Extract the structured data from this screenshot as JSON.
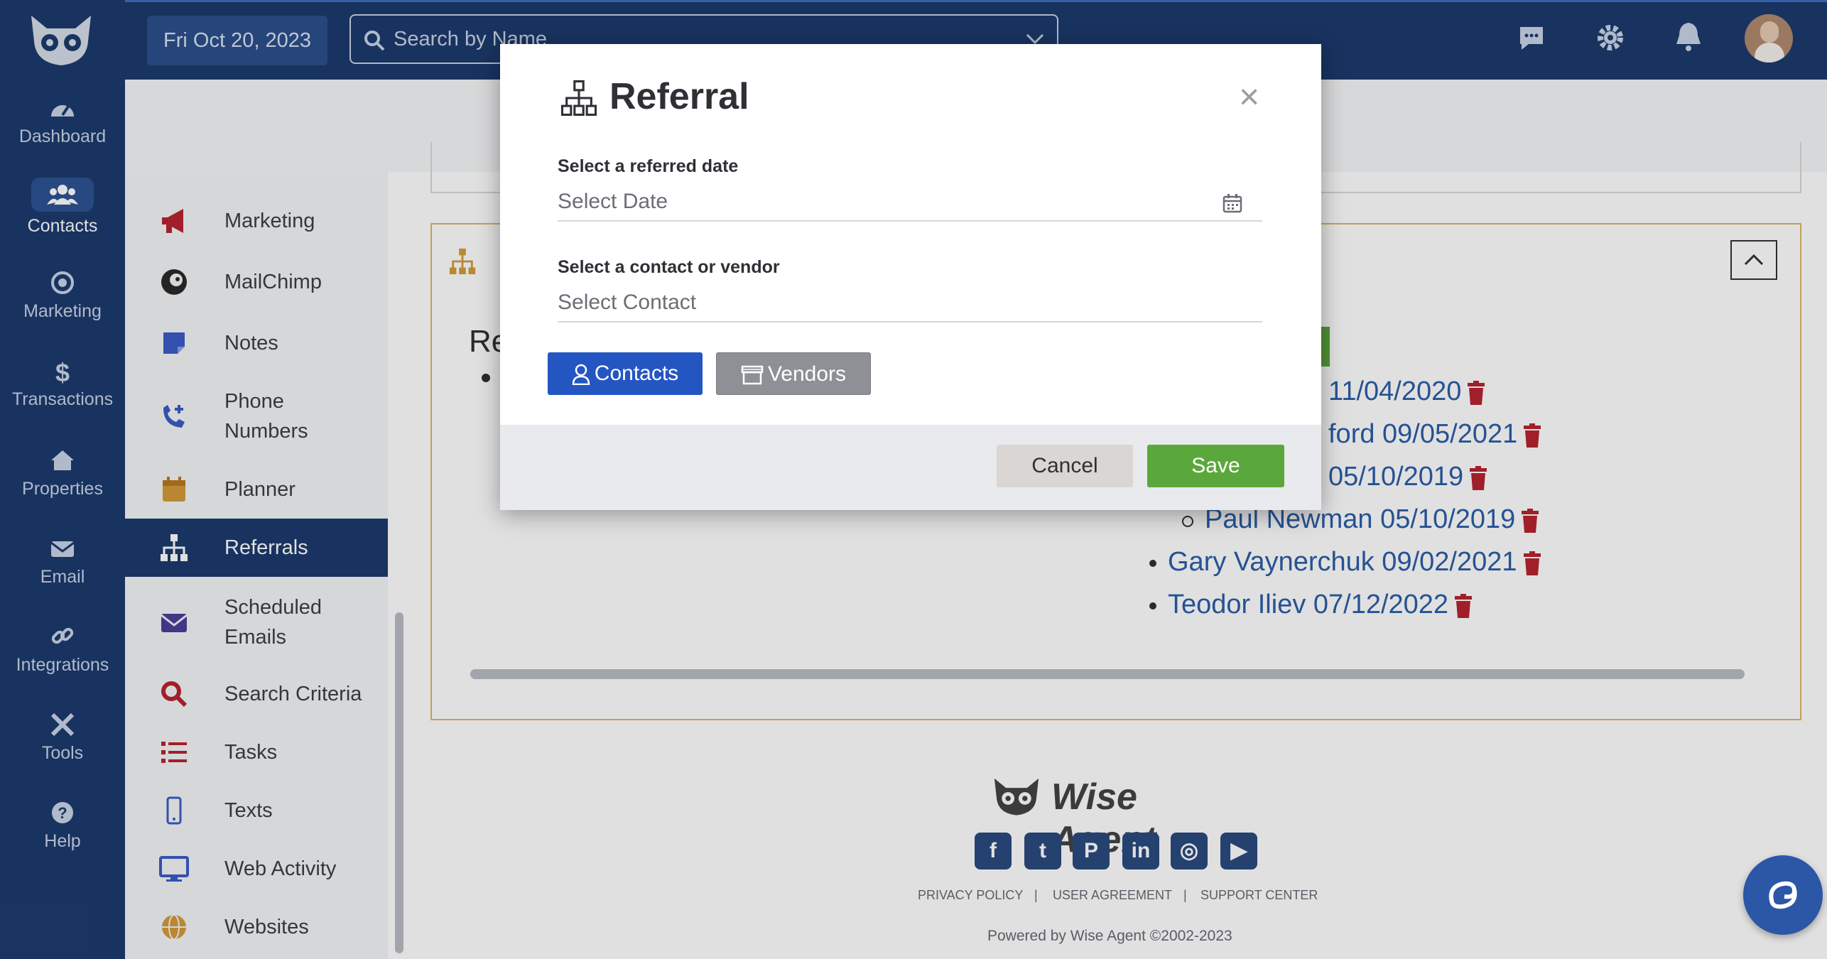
{
  "header": {
    "date": "Fri Oct 20, 2023",
    "search_placeholder": "Search by Name"
  },
  "rail": {
    "items": [
      {
        "label": "Dashboard"
      },
      {
        "label": "Contacts"
      },
      {
        "label": "Marketing"
      },
      {
        "label": "Transactions"
      },
      {
        "label": "Properties"
      },
      {
        "label": "Email"
      },
      {
        "label": "Integrations"
      },
      {
        "label": "Tools"
      },
      {
        "label": "Help"
      }
    ]
  },
  "subnav": {
    "items": [
      {
        "label": "Marketing"
      },
      {
        "label": "MailChimp"
      },
      {
        "label": "Notes"
      },
      {
        "label": "Phone Numbers"
      },
      {
        "label": "Planner"
      },
      {
        "label": "Referrals"
      },
      {
        "label": "Scheduled Emails"
      },
      {
        "label": "Search Criteria"
      },
      {
        "label": "Tasks"
      },
      {
        "label": "Texts"
      },
      {
        "label": "Web Activity"
      },
      {
        "label": "Websites"
      }
    ],
    "active": "Referrals"
  },
  "referrals_panel": {
    "heading_fragment": "Re",
    "visible_entries": [
      {
        "text": "11/04/2020"
      },
      {
        "text": "ford 09/05/2021"
      },
      {
        "text": "05/10/2019"
      },
      {
        "text": "Paul Newman 05/10/2019"
      },
      {
        "text": "Gary Vaynerchuk 09/02/2021"
      },
      {
        "text": "Teodor Iliev 07/12/2022"
      }
    ]
  },
  "modal": {
    "title": "Referral",
    "date_label": "Select a referred date",
    "date_placeholder": "Select Date",
    "contact_label": "Select a contact or vendor",
    "contact_placeholder": "Select Contact",
    "contacts_button": "Contacts",
    "vendors_button": "Vendors",
    "cancel_button": "Cancel",
    "save_button": "Save",
    "close_glyph": "×"
  },
  "footer": {
    "brand": "Wise Agent",
    "links": [
      "PRIVACY POLICY",
      "|",
      "USER AGREEMENT",
      "|",
      "SUPPORT CENTER"
    ],
    "powered": "Powered by Wise Agent ©2002-2023"
  },
  "colors": {
    "navy": "#1d3b6e",
    "primary_blue": "#2456c2",
    "save_green": "#5aa83c",
    "trash_red": "#b82430",
    "link_blue": "#2b5ea8"
  }
}
